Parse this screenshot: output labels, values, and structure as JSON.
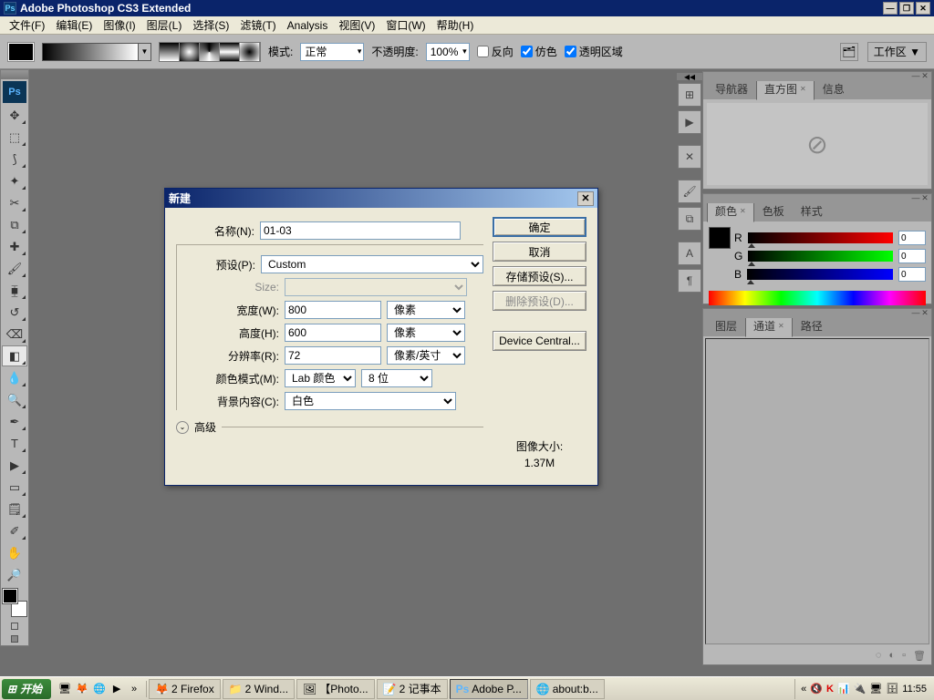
{
  "window": {
    "title": "Adobe Photoshop CS3 Extended",
    "logo_text": "Ps"
  },
  "menubar": [
    "文件(F)",
    "编辑(E)",
    "图像(I)",
    "图层(L)",
    "选择(S)",
    "滤镜(T)",
    "Analysis",
    "视图(V)",
    "窗口(W)",
    "帮助(H)"
  ],
  "optionsbar": {
    "mode_label": "模式:",
    "mode_value": "正常",
    "opacity_label": "不透明度:",
    "opacity_value": "100%",
    "chk_reverse": "反向",
    "chk_dither": "仿色",
    "chk_transparency": "透明区域",
    "workspace_label": "工作区 ▼"
  },
  "panels": {
    "navigator": {
      "tabs": [
        "导航器",
        "直方图",
        "信息"
      ],
      "active": 1
    },
    "color": {
      "tabs": [
        "颜色",
        "色板",
        "样式"
      ],
      "active": 0,
      "channels": [
        {
          "label": "R",
          "value": "0"
        },
        {
          "label": "G",
          "value": "0"
        },
        {
          "label": "B",
          "value": "0"
        }
      ]
    },
    "layers": {
      "tabs": [
        "图层",
        "通道",
        "路径"
      ],
      "active": 1
    }
  },
  "dialog": {
    "title": "新建",
    "labels": {
      "name": "名称(N):",
      "preset": "预设(P):",
      "size": "Size:",
      "width": "宽度(W):",
      "height": "高度(H):",
      "resolution": "分辨率(R):",
      "color_mode": "颜色模式(M):",
      "background": "背景内容(C):",
      "advanced": "高级",
      "image_size_label": "图像大小:"
    },
    "values": {
      "name": "01-03",
      "preset": "Custom",
      "size": "",
      "width": "800",
      "width_unit": "像素",
      "height": "600",
      "height_unit": "像素",
      "resolution": "72",
      "resolution_unit": "像素/英寸",
      "color_mode": "Lab 颜色",
      "bit_depth": "8 位",
      "background": "白色",
      "image_size": "1.37M"
    },
    "buttons": {
      "ok": "确定",
      "cancel": "取消",
      "save_preset": "存储预设(S)...",
      "delete_preset": "删除预设(D)...",
      "device_central": "Device Central..."
    }
  },
  "taskbar": {
    "start": "开始",
    "tasks": [
      {
        "icon": "🦊",
        "label": "2 Firefox"
      },
      {
        "icon": "📁",
        "label": "2 Wind..."
      },
      {
        "icon": "🖼",
        "label": "【Photo..."
      },
      {
        "icon": "📝",
        "label": "2 记事本"
      },
      {
        "icon": "Ps",
        "label": "Adobe P...",
        "active": true
      },
      {
        "icon": "🌐",
        "label": "about:b..."
      }
    ],
    "clock": "11:55"
  }
}
